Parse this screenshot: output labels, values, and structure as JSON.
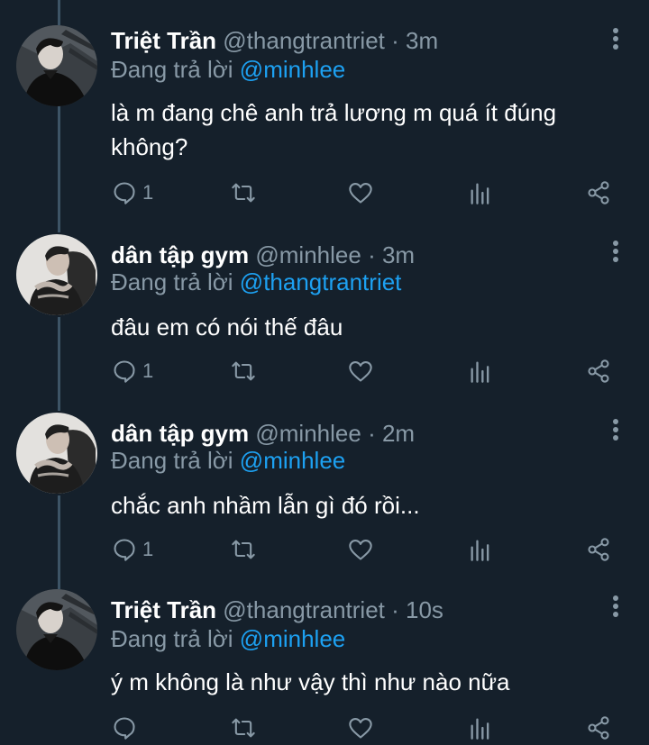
{
  "tweets": [
    {
      "name": "Triệt Trần",
      "handle": "@thangtrantriet",
      "time": "· 3m",
      "reply_prefix": "Đang trả lời",
      "reply_to": "@minhlee",
      "text": "là m đang chê anh trả lương m quá ít đúng không?",
      "reply_count": "1",
      "avatar": "dark-portrait-avatar"
    },
    {
      "name": "dân tập gym",
      "handle": "@minhlee",
      "time": "· 3m",
      "reply_prefix": "Đang trả lời",
      "reply_to": "@thangtrantriet",
      "text": "đâu em có nói thế đâu",
      "reply_count": "1",
      "avatar": "light-portrait-avatar"
    },
    {
      "name": "dân tập gym",
      "handle": "@minhlee",
      "time": "· 2m",
      "reply_prefix": "Đang trả lời",
      "reply_to": "@minhlee",
      "text": "chắc anh nhầm lẫn gì đó rồi...",
      "reply_count": "1",
      "avatar": "light-portrait-avatar"
    },
    {
      "name": "Triệt Trần",
      "handle": "@thangtrantriet",
      "time": "· 10s",
      "reply_prefix": "Đang trả lời",
      "reply_to": "@minhlee",
      "text": "ý m không là như vậy thì như nào nữa",
      "reply_count": "",
      "avatar": "dark-portrait-avatar"
    }
  ],
  "icons": [
    "reply-icon",
    "retweet-icon",
    "like-icon",
    "analytics-icon",
    "share-icon",
    "more-icon"
  ],
  "colors": {
    "background": "#15202b",
    "text": "#ffffff",
    "muted": "#8899a6",
    "mention": "#1da1f2",
    "thread_line": "#3d5466"
  }
}
